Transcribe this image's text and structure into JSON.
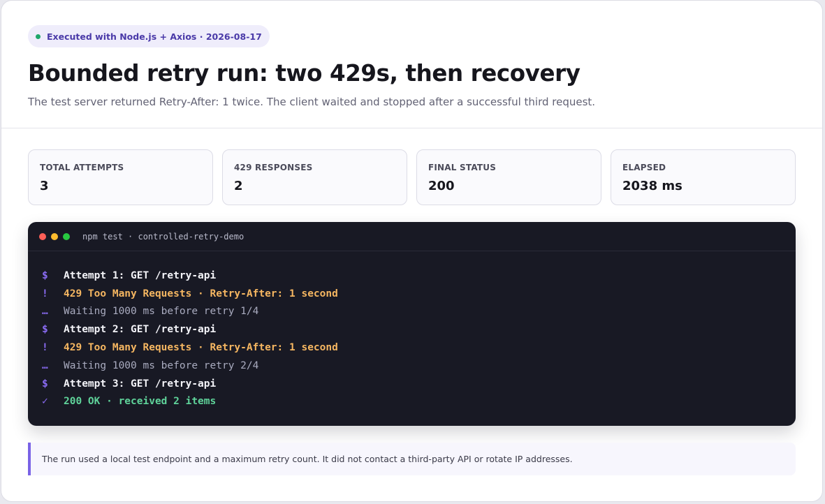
{
  "badge": {
    "text": "Executed with Node.js + Axios · 2026-08-17",
    "dot_color": "#1fa76a"
  },
  "title": "Bounded retry run: two 429s, then recovery",
  "subtitle": "The test server returned Retry-After: 1 twice. The client waited and stopped after a successful third request.",
  "stats": [
    {
      "label": "TOTAL ATTEMPTS",
      "value": "3"
    },
    {
      "label": "429 RESPONSES",
      "value": "2"
    },
    {
      "label": "FINAL STATUS",
      "value": "200"
    },
    {
      "label": "ELAPSED",
      "value": "2038 ms"
    }
  ],
  "terminal": {
    "title": "npm test · controlled-retry-demo",
    "window_controls": [
      "#ff5f57",
      "#febc2e",
      "#28c840"
    ],
    "lines": [
      {
        "symbol": "$",
        "text": "Attempt 1: GET /retry-api",
        "kind": "cmd"
      },
      {
        "symbol": "!",
        "text": "429 Too Many Requests · Retry-After: 1 second",
        "kind": "warn"
      },
      {
        "symbol": "…",
        "text": "Waiting 1000 ms before retry 1/4",
        "kind": "wait"
      },
      {
        "symbol": "$",
        "text": "Attempt 2: GET /retry-api",
        "kind": "cmd"
      },
      {
        "symbol": "!",
        "text": "429 Too Many Requests · Retry-After: 1 second",
        "kind": "warn"
      },
      {
        "symbol": "…",
        "text": "Waiting 1000 ms before retry 2/4",
        "kind": "wait"
      },
      {
        "symbol": "$",
        "text": "Attempt 3: GET /retry-api",
        "kind": "cmd"
      },
      {
        "symbol": "✓",
        "text": "200 OK · received 2 items",
        "kind": "ok"
      }
    ]
  },
  "note": "The run used a local test endpoint and a maximum retry count. It did not contact a third-party API or rotate IP addresses.",
  "colors": {
    "accent": "#7a63e6",
    "terminal_bg": "#181924",
    "warn": "#f5b661",
    "ok": "#5fd39a"
  }
}
